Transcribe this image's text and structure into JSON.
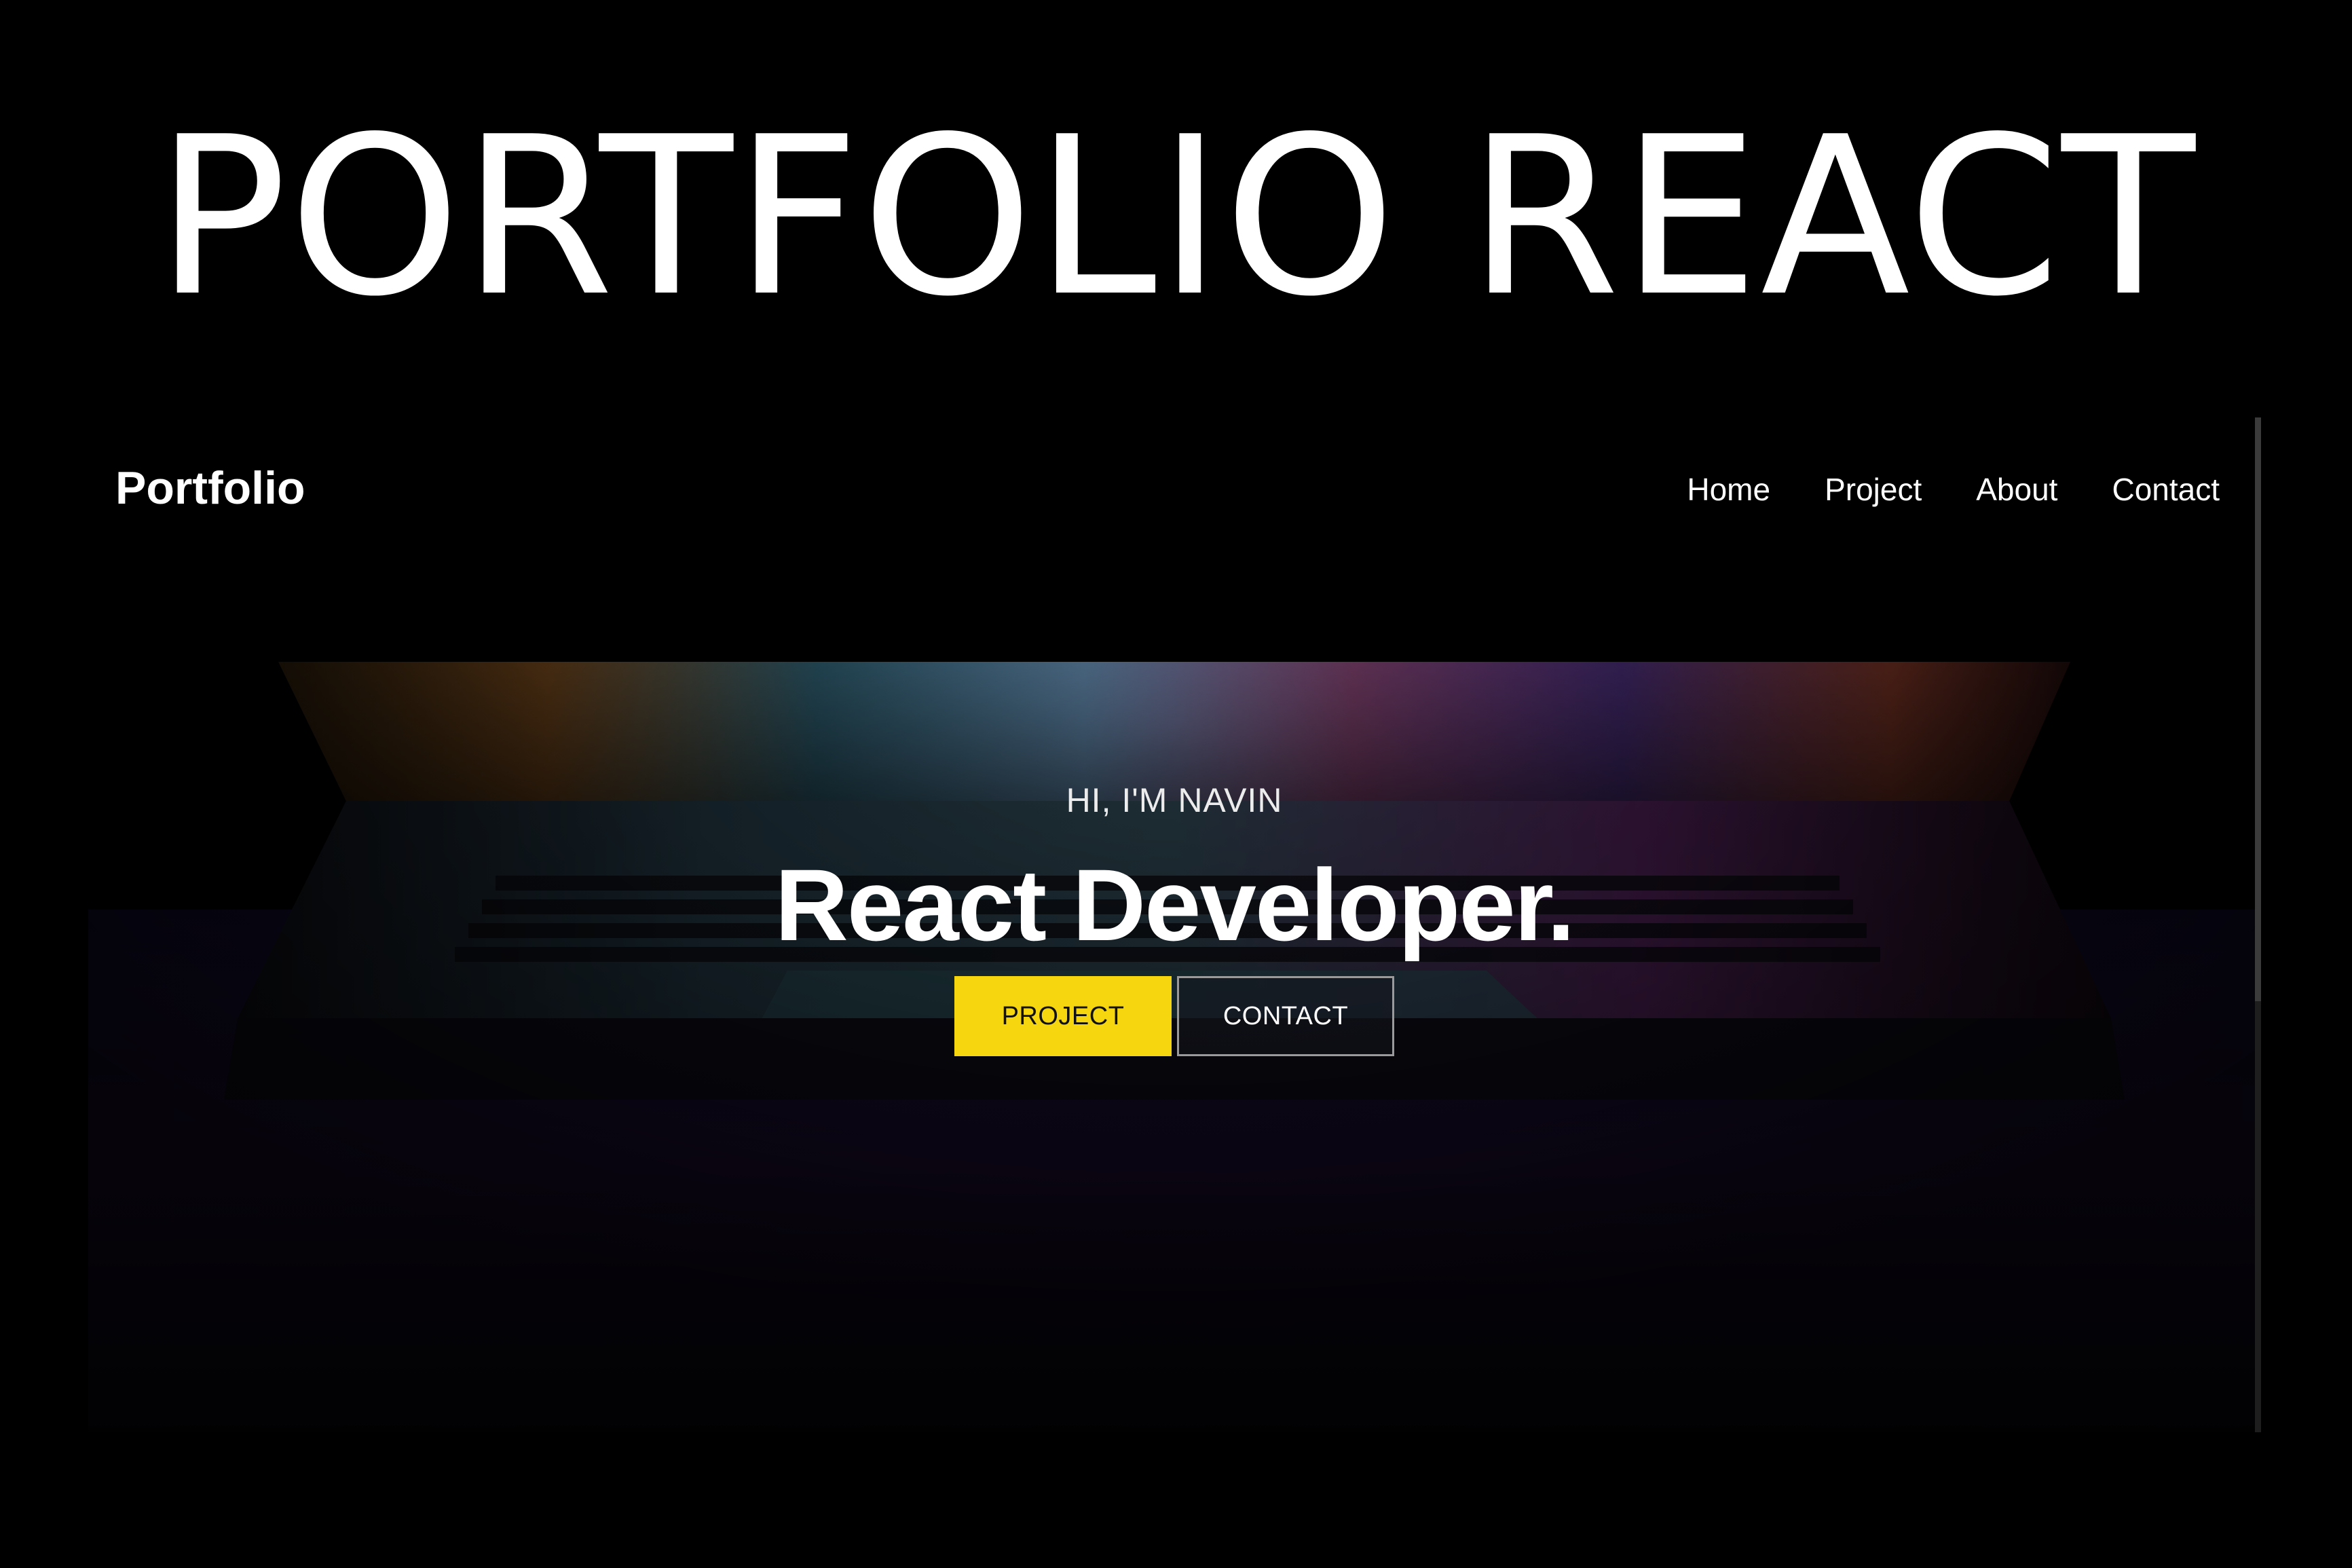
{
  "banner": {
    "title": "PORTFOLIO REACT"
  },
  "site": {
    "brand": "Portfolio",
    "nav": [
      {
        "label": "Home"
      },
      {
        "label": "Project"
      },
      {
        "label": "About"
      },
      {
        "label": "Contact"
      }
    ],
    "hero": {
      "greeting": "HI, I'M NAVIN",
      "headline": "React Developer.",
      "primary_button": "PROJECT",
      "secondary_button": "CONTACT"
    }
  },
  "colors": {
    "background": "#000000",
    "accent_yellow": "#f5d60f",
    "text": "#ffffff"
  }
}
